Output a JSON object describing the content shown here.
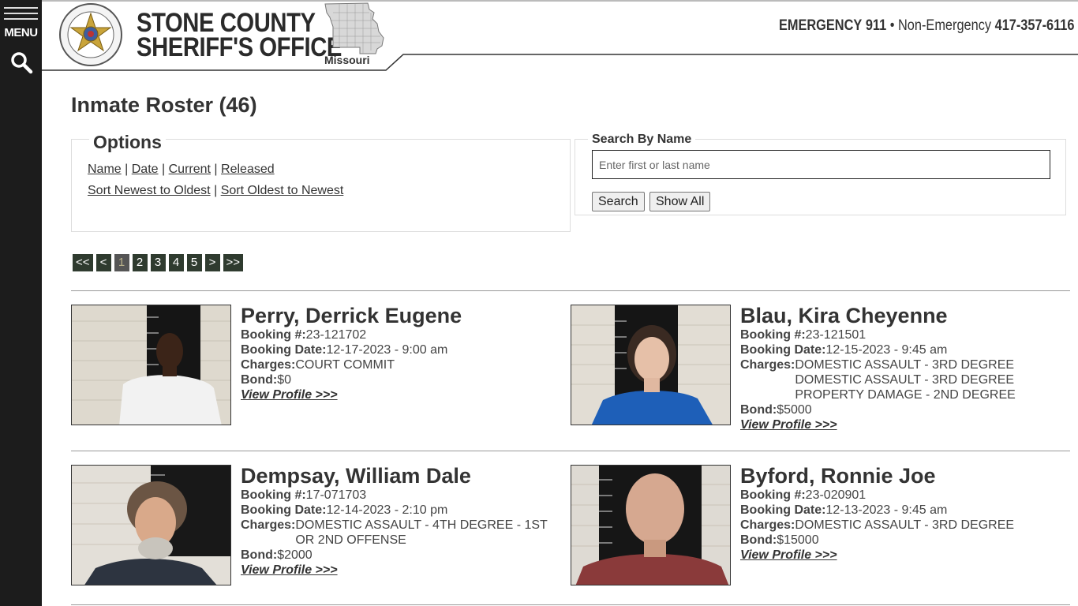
{
  "sidebar": {
    "menu_label": "MENU"
  },
  "header": {
    "title_line1": "STONE COUNTY",
    "title_line2": "SHERIFF'S OFFICE",
    "state_label": "Missouri",
    "emergency_label": "EMERGENCY",
    "emergency_number": "911",
    "separator": "•",
    "nonemergency_label": "Non-Emergency",
    "nonemergency_number": "417-357-6116"
  },
  "page": {
    "title": "Inmate Roster (46)"
  },
  "options": {
    "legend": "Options",
    "links_row1": [
      "Name",
      "Date",
      "Current",
      "Released"
    ],
    "links_row2": [
      "Sort Newest to Oldest",
      "Sort Oldest to Newest"
    ],
    "separator": "|"
  },
  "search": {
    "legend": "Search By Name",
    "placeholder": "Enter first or last name",
    "search_button": "Search",
    "show_all_button": "Show All"
  },
  "pager": [
    "<<",
    "<",
    "1",
    "2",
    "3",
    "4",
    "5",
    ">",
    ">>"
  ],
  "pager_active": "1",
  "labels": {
    "booking_num": "Booking #:",
    "booking_date": "Booking Date:",
    "charges": "Charges:",
    "bond": "Bond:",
    "view_profile": "View Profile >>>"
  },
  "inmates": [
    {
      "name": "Perry, Derrick Eugene",
      "booking_num": "23-121702",
      "booking_date": "12-17-2023 - 9:00 am",
      "charges": [
        "COURT COMMIT"
      ],
      "bond": "$0"
    },
    {
      "name": "Blau, Kira Cheyenne",
      "booking_num": "23-121501",
      "booking_date": "12-15-2023 - 9:45 am",
      "charges": [
        "DOMESTIC ASSAULT - 3RD DEGREE",
        "DOMESTIC ASSAULT - 3RD DEGREE",
        "PROPERTY DAMAGE - 2ND DEGREE"
      ],
      "bond": "$5000"
    },
    {
      "name": "Dempsay, William Dale",
      "booking_num": "17-071703",
      "booking_date": "12-14-2023 - 2:10 pm",
      "charges": [
        "DOMESTIC ASSAULT - 4TH DEGREE - 1ST OR 2ND OFFENSE"
      ],
      "bond": "$2000"
    },
    {
      "name": "Byford, Ronnie Joe",
      "booking_num": "23-020901",
      "booking_date": "12-13-2023 - 9:45 am",
      "charges": [
        "DOMESTIC ASSAULT - 3RD DEGREE"
      ],
      "bond": "$15000"
    }
  ]
}
